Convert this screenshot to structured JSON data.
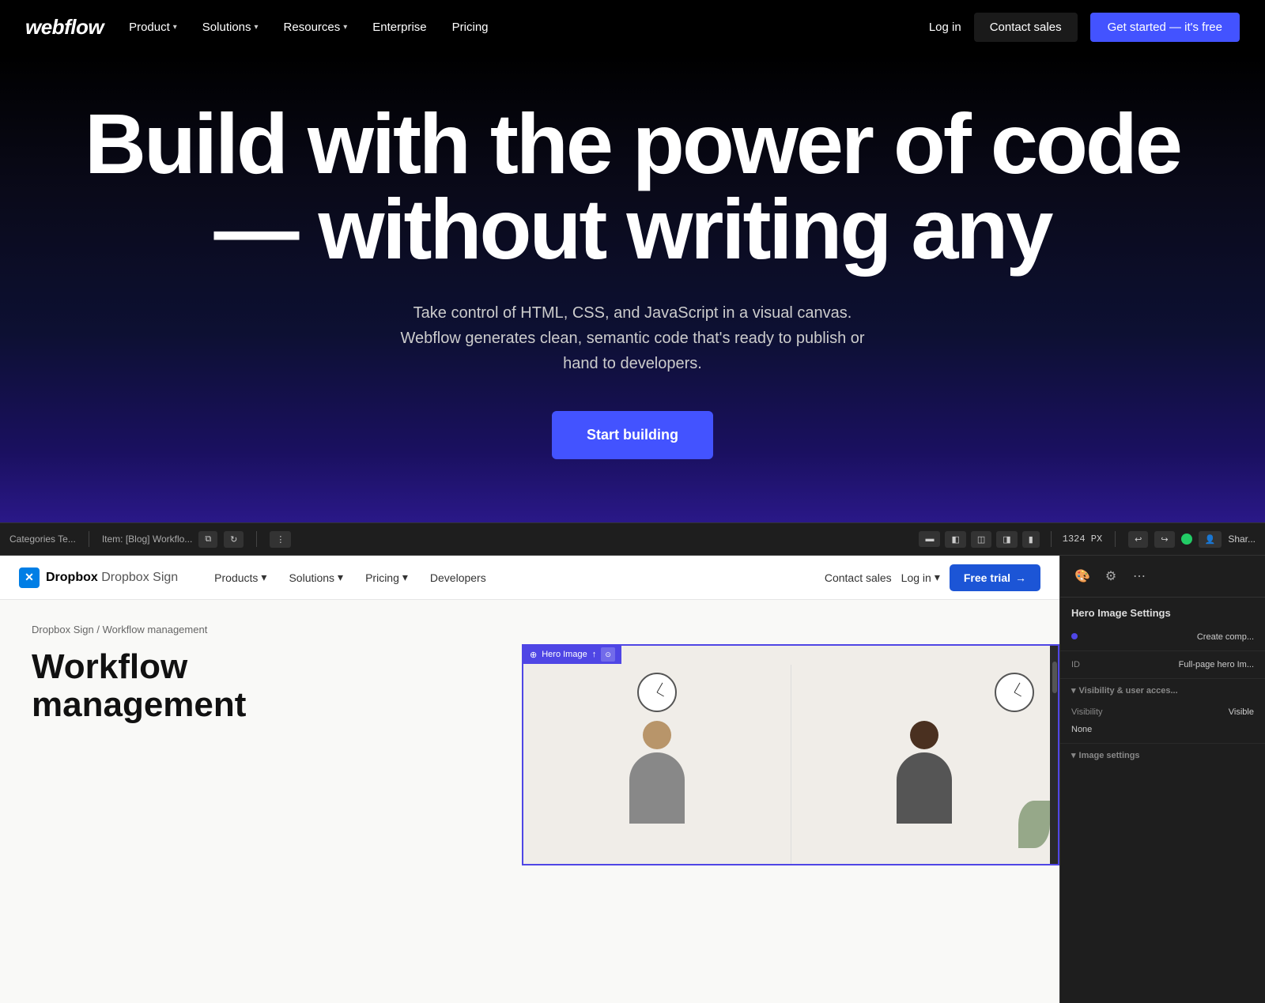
{
  "site": "webflow",
  "navbar": {
    "logo": "webflow",
    "items": [
      {
        "label": "Product",
        "hasDropdown": true
      },
      {
        "label": "Solutions",
        "hasDropdown": true
      },
      {
        "label": "Resources",
        "hasDropdown": true
      },
      {
        "label": "Enterprise",
        "hasDropdown": false
      },
      {
        "label": "Pricing",
        "hasDropdown": false
      }
    ],
    "login_label": "Log in",
    "contact_label": "Contact sales",
    "cta_label": "Get started — it's free"
  },
  "hero": {
    "title": "Build with the power of code — without writing any",
    "subtitle": "Take control of HTML, CSS, and JavaScript in a visual canvas. Webflow generates clean, semantic code that's ready to publish or hand to developers.",
    "cta_label": "Start building"
  },
  "canvas_toolbar": {
    "breadcrumb": "Categories Te...",
    "item_label": "Item: [Blog] Workflo...",
    "px_display": "1324 PX",
    "share_label": "Shar..."
  },
  "dropbox_nav": {
    "logo_text": "Dropbox Sign",
    "items": [
      {
        "label": "Products",
        "hasDropdown": true
      },
      {
        "label": "Solutions",
        "hasDropdown": true
      },
      {
        "label": "Pricing",
        "hasDropdown": true
      },
      {
        "label": "Developers",
        "hasDropdown": false
      }
    ],
    "contact_label": "Contact sales",
    "login_label": "Log in",
    "cta_label": "Free trial",
    "cta_arrow": "→"
  },
  "dropbox_page": {
    "breadcrumb": "Dropbox Sign / Workflow management",
    "title": "Workflow management"
  },
  "hero_image_element": {
    "label": "Hero Image",
    "badge": "⊕"
  },
  "right_panel": {
    "title": "Hero Image Settings",
    "create_component_label": "Create comp...",
    "id_label": "ID",
    "id_value": "Full-page hero Im...",
    "sections": {
      "visibility": {
        "header": "Visibility & user acces...",
        "label": "Visibility",
        "value": "Visible",
        "extra_value": "None"
      },
      "image_settings": {
        "header": "Image settings"
      }
    }
  },
  "colors": {
    "webflow_blue": "#4353ff",
    "dropbox_blue": "#1c55d6",
    "highlight_purple": "#4f46e5",
    "bg_dark": "#000000",
    "bg_canvas": "#1e1e1e",
    "green_status": "#22cc66"
  }
}
